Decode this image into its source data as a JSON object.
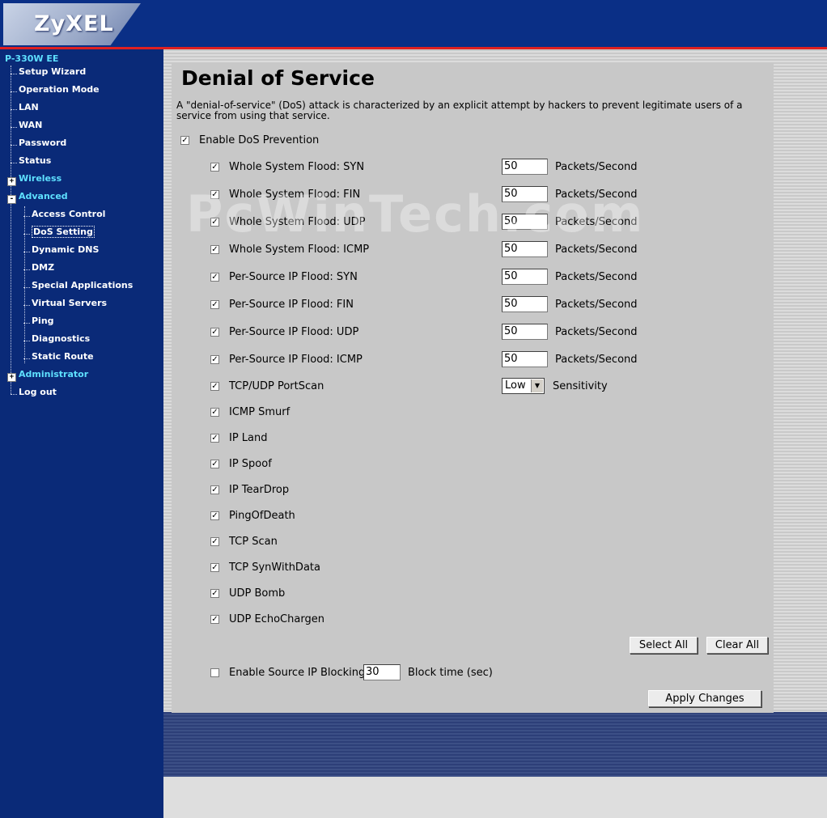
{
  "header": {
    "logo_text": "ZyXEL"
  },
  "sidebar": {
    "device": "P-330W EE",
    "items": [
      {
        "label": "Setup Wizard"
      },
      {
        "label": "Operation Mode"
      },
      {
        "label": "LAN"
      },
      {
        "label": "WAN"
      },
      {
        "label": "Password"
      },
      {
        "label": "Status"
      },
      {
        "label": "Wireless"
      },
      {
        "label": "Advanced"
      },
      {
        "label": "Access Control"
      },
      {
        "label": "DoS Setting"
      },
      {
        "label": "Dynamic DNS"
      },
      {
        "label": "DMZ"
      },
      {
        "label": "Special Applications"
      },
      {
        "label": "Virtual Servers"
      },
      {
        "label": "Ping"
      },
      {
        "label": "Diagnostics"
      },
      {
        "label": "Static Route"
      },
      {
        "label": "Administrator"
      },
      {
        "label": "Log out"
      }
    ],
    "plus": "+",
    "minus": "-"
  },
  "watermark": "PcWinTech.com",
  "page": {
    "title": "Denial of Service",
    "description": "A \"denial-of-service\" (DoS) attack is characterized by an explicit attempt by hackers to prevent legitimate users of a service from using that service.",
    "enable_label": "Enable DoS Prevention",
    "check": "✓",
    "floods": [
      {
        "label": "Whole System Flood: SYN",
        "value": "50",
        "unit": "Packets/Second"
      },
      {
        "label": "Whole System Flood: FIN",
        "value": "50",
        "unit": "Packets/Second"
      },
      {
        "label": "Whole System Flood: UDP",
        "value": "50",
        "unit": "Packets/Second"
      },
      {
        "label": "Whole System Flood: ICMP",
        "value": "50",
        "unit": "Packets/Second"
      },
      {
        "label": "Per-Source IP Flood: SYN",
        "value": "50",
        "unit": "Packets/Second"
      },
      {
        "label": "Per-Source IP Flood: FIN",
        "value": "50",
        "unit": "Packets/Second"
      },
      {
        "label": "Per-Source IP Flood: UDP",
        "value": "50",
        "unit": "Packets/Second"
      },
      {
        "label": "Per-Source IP Flood: ICMP",
        "value": "50",
        "unit": "Packets/Second"
      }
    ],
    "portscan": {
      "label": "TCP/UDP PortScan",
      "selected": "Low",
      "unit": "Sensitivity",
      "arrow": "▼"
    },
    "attacks": [
      {
        "label": "ICMP Smurf"
      },
      {
        "label": "IP Land"
      },
      {
        "label": "IP Spoof"
      },
      {
        "label": "IP TearDrop"
      },
      {
        "label": "PingOfDeath"
      },
      {
        "label": "TCP Scan"
      },
      {
        "label": "TCP SynWithData"
      },
      {
        "label": "UDP Bomb"
      },
      {
        "label": "UDP EchoChargen"
      }
    ],
    "select_all": "Select All",
    "clear_all": "Clear All",
    "block": {
      "label": "Enable Source IP Blocking",
      "value": "30",
      "unit": "Block time (sec)"
    },
    "apply": "Apply Changes"
  }
}
